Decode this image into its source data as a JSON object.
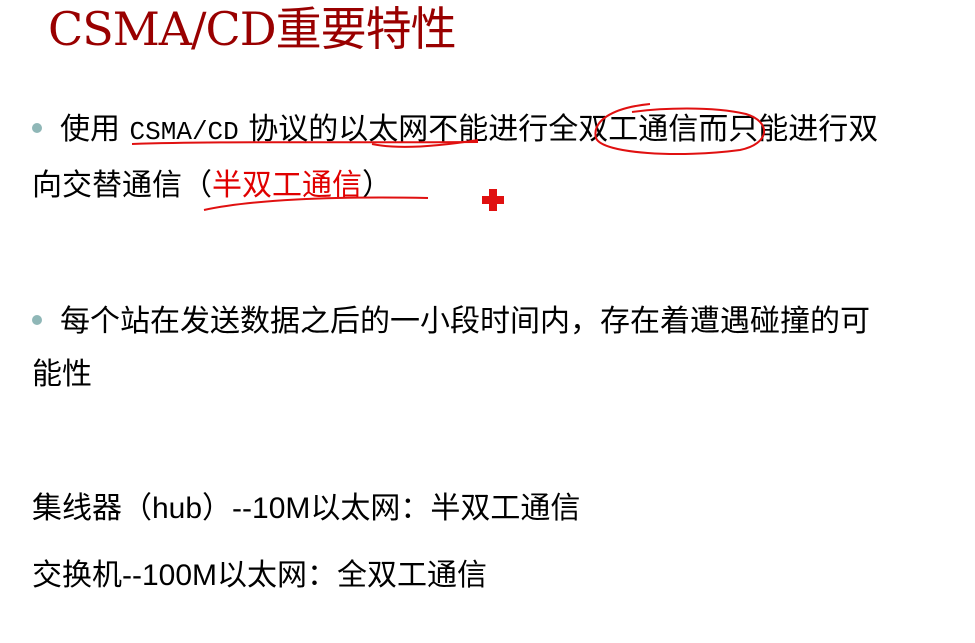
{
  "title": "CSMA/CD重要特性",
  "bullet1": {
    "pre": "使用 ",
    "mono": "CSMA/CD",
    "mid": " 协议的以太网不能进行全双工通信而只能进行双",
    "line2_pre": "向交替通信（",
    "line2_red": "半双工通信",
    "line2_post": "）"
  },
  "bullet2": {
    "line1": "每个站在发送数据之后的一小段时间内，存在着遭遇碰撞的可",
    "line2": "能性"
  },
  "note1": {
    "pre": "集线器（",
    "sans": "hub）--10M",
    "post": "以太网：半双工通信"
  },
  "note2": {
    "pre": "交换机",
    "sans": "--100M",
    "post": "以太网：全双工通信"
  },
  "colors": {
    "title": "#990000",
    "highlight": "#e00000",
    "bullet": "#8fb7b7",
    "ink": "#e01010"
  }
}
